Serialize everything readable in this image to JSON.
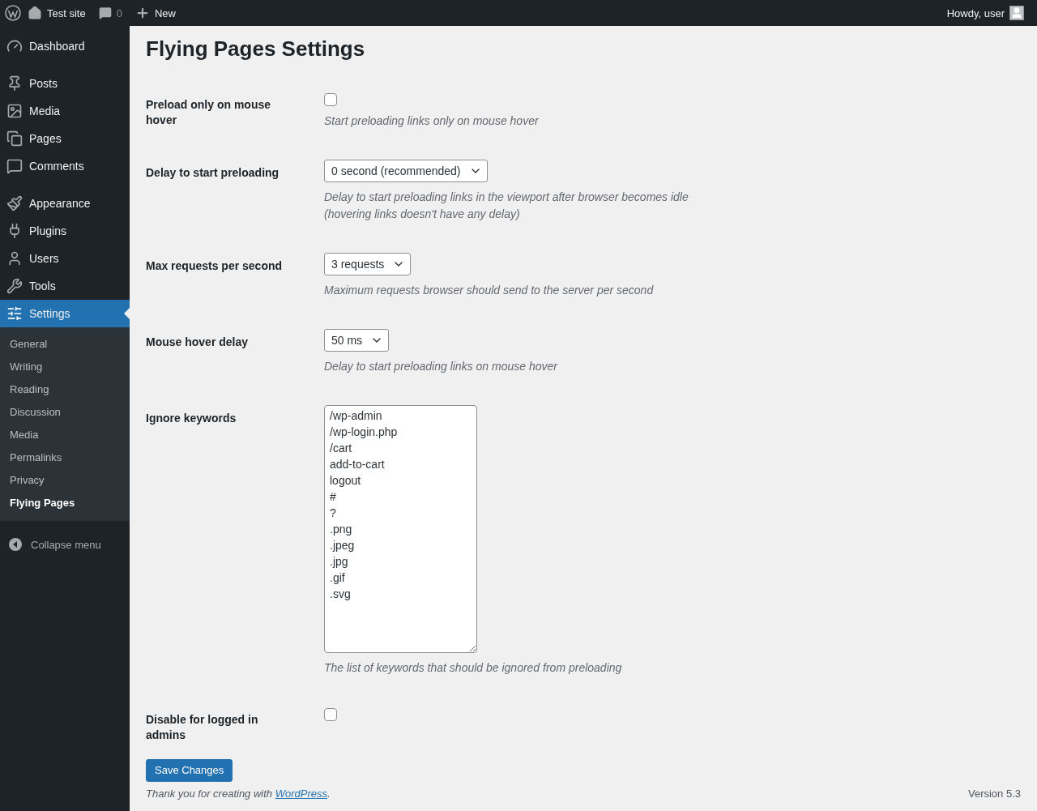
{
  "admin_bar": {
    "site_name": "Test site",
    "comments_count": "0",
    "new_label": "New",
    "greeting": "Howdy, user"
  },
  "menu_groups": [
    [
      {
        "label": "Dashboard",
        "selected": false
      }
    ],
    [
      {
        "label": "Posts",
        "selected": false
      },
      {
        "label": "Media",
        "selected": false
      },
      {
        "label": "Pages",
        "selected": false
      },
      {
        "label": "Comments",
        "selected": false
      }
    ],
    [
      {
        "label": "Appearance",
        "selected": false
      },
      {
        "label": "Plugins",
        "selected": false
      },
      {
        "label": "Users",
        "selected": false
      },
      {
        "label": "Tools",
        "selected": false
      },
      {
        "label": "Settings",
        "selected": true
      }
    ]
  ],
  "submenu": [
    {
      "label": "General",
      "selected": false
    },
    {
      "label": "Writing",
      "selected": false
    },
    {
      "label": "Reading",
      "selected": false
    },
    {
      "label": "Discussion",
      "selected": false
    },
    {
      "label": "Media",
      "selected": false
    },
    {
      "label": "Permalinks",
      "selected": false
    },
    {
      "label": "Privacy",
      "selected": false
    },
    {
      "label": "Flying Pages",
      "selected": true
    }
  ],
  "collapse_label": "Collapse menu",
  "page_title": "Flying Pages Settings",
  "settings": [
    {
      "kind": "checkbox",
      "label": "Preload only on mouse hover",
      "checked": false,
      "description": "Start preloading links only on mouse hover"
    },
    {
      "kind": "select",
      "label": "Delay to start preloading",
      "value": "0 second (recommended)",
      "description": "Delay to start preloading links in the viewport after browser becomes idle (hovering links doesn't have any delay)"
    },
    {
      "kind": "select",
      "label": "Max requests per second",
      "value": "3 requests",
      "description": "Maximum requests browser should send to the server per second"
    },
    {
      "kind": "select",
      "label": "Mouse hover delay",
      "value": "50 ms",
      "description": "Delay to start preloading links on mouse hover"
    },
    {
      "kind": "textarea",
      "label": "Ignore keywords",
      "lines": [
        "/wp-admin",
        "/wp-login.php",
        "/cart",
        "add-to-cart",
        "logout",
        "#",
        "?",
        ".png",
        ".jpeg",
        ".jpg",
        ".gif",
        ".svg"
      ],
      "description": "The list of keywords that should be ignored from preloading"
    },
    {
      "kind": "checkbox",
      "label": "Disable for logged in admins",
      "checked": false
    }
  ],
  "save_button": "Save Changes",
  "footer": {
    "thanks": "Thank you for creating with",
    "link": "WordPress",
    "end": ".",
    "version": "Version 5.3"
  }
}
